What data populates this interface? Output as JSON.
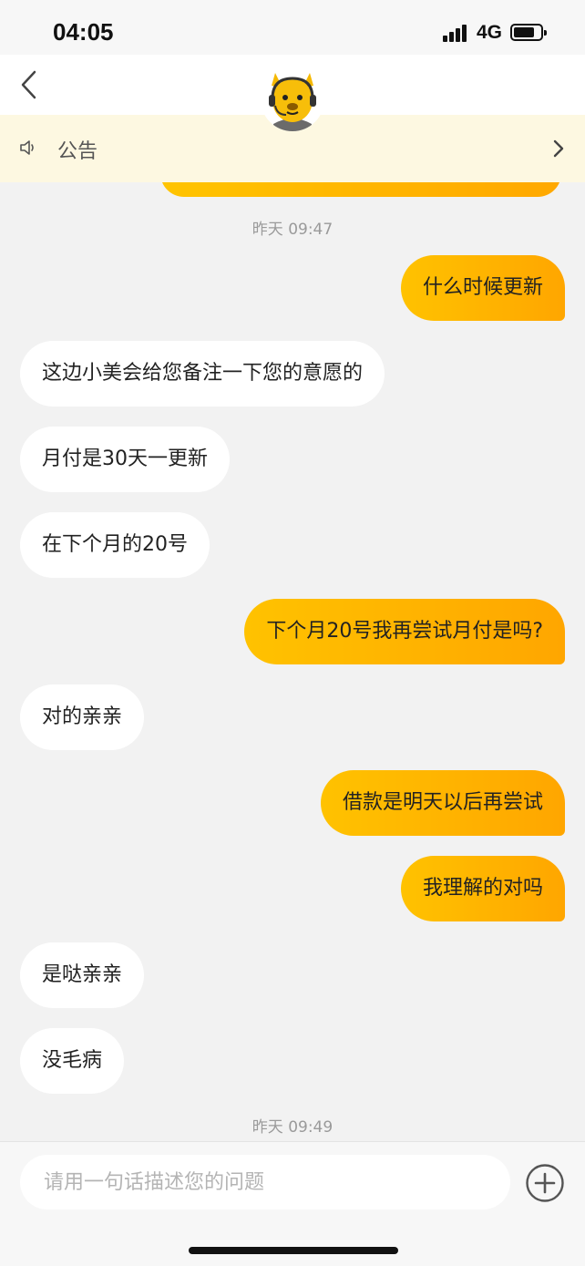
{
  "status": {
    "time": "04:05",
    "network": "4G"
  },
  "notice": {
    "label": "公告"
  },
  "timestamps": [
    "昨天 09:47",
    "昨天 09:49"
  ],
  "messages": [
    {
      "side": "sent",
      "text": "什么时候更新"
    },
    {
      "side": "recv",
      "text": "这边小美会给您备注一下您的意愿的"
    },
    {
      "side": "recv",
      "text": "月付是30天一更新"
    },
    {
      "side": "recv",
      "text": "在下个月的20号"
    },
    {
      "side": "sent",
      "text": "下个月20号我再尝试月付是吗?"
    },
    {
      "side": "recv",
      "text": "对的亲亲"
    },
    {
      "side": "sent",
      "text": "借款是明天以后再尝试"
    },
    {
      "side": "sent",
      "text": "我理解的对吗"
    },
    {
      "side": "recv",
      "text": "是哒亲亲"
    },
    {
      "side": "recv",
      "text": "没毛病"
    }
  ],
  "input": {
    "placeholder": "请用一句话描述您的问题",
    "value": ""
  },
  "colors": {
    "accent": "#ffb800",
    "bubble_recv": "#ffffff",
    "background": "#f2f2f2",
    "notice_bg": "#fdf8e1"
  },
  "icons": {
    "back": "chevron-left-icon",
    "avatar": "mascot-avatar-icon",
    "notice": "speaker-icon",
    "notice_more": "chevron-right-icon",
    "add": "plus-circle-icon"
  }
}
